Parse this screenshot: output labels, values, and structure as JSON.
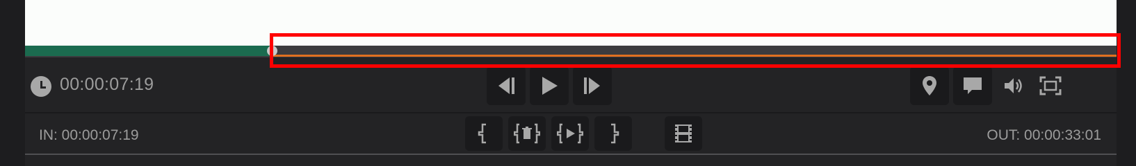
{
  "player": {
    "current_time": "00:00:07:19",
    "in_point": "IN: 00:00:07:19",
    "out_point": "OUT: 00:00:33:01",
    "timeline": {
      "playhead_fraction": 0.226,
      "range_start_fraction": 0.226,
      "range_end_fraction": 1.0
    }
  },
  "colors": {
    "played": "#1b6b4f",
    "range": "#e07020",
    "highlight": "#ff0000"
  },
  "icons": {
    "clock": "clock-icon",
    "prev_frame": "step-back-icon",
    "play": "play-icon",
    "next_frame": "step-forward-icon",
    "set_in": "mark-in-icon",
    "clear_range": "clear-in-out-icon",
    "play_range": "play-in-out-icon",
    "set_out": "mark-out-icon",
    "filmstrip": "filmstrip-icon",
    "marker": "location-pin-icon",
    "comment": "comment-icon",
    "volume": "volume-icon",
    "fullscreen": "fullscreen-icon"
  }
}
